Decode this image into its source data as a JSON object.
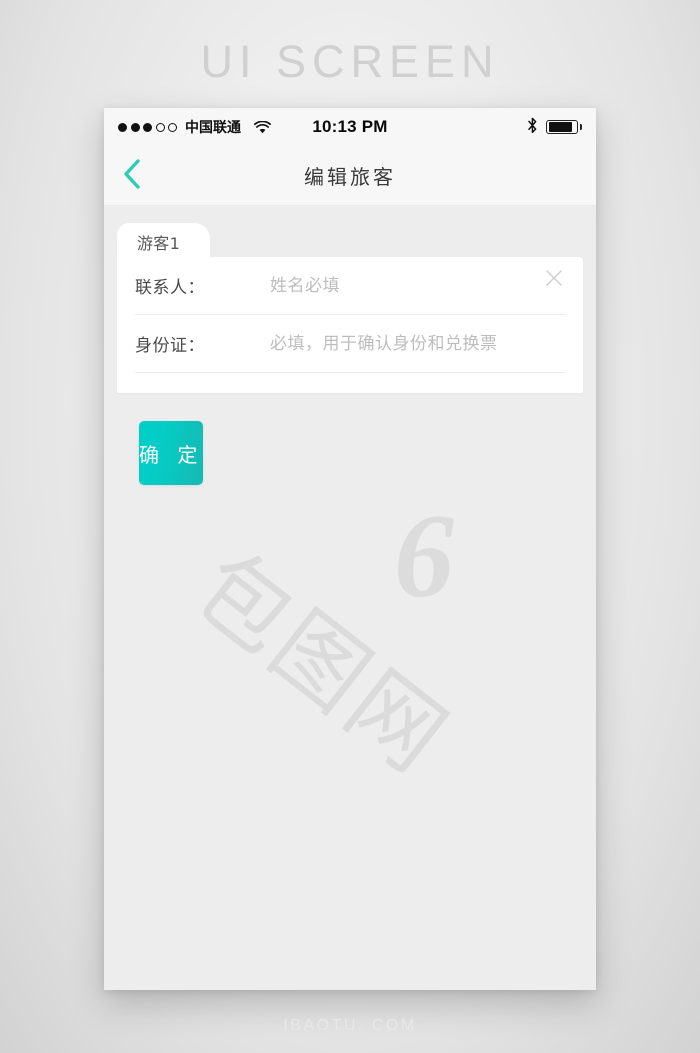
{
  "poster": {
    "title": "UI SCREEN",
    "footer": "IBAOTU. COM",
    "watermark_text": "包图网",
    "watermark_logo": "6"
  },
  "status_bar": {
    "signal_filled": 3,
    "signal_empty": 2,
    "carrier": "中国联通",
    "wifi_icon": "wifi-icon",
    "time": "10:13 PM",
    "bluetooth_icon": "bluetooth-icon",
    "battery_icon": "battery-icon",
    "battery_level": 88
  },
  "nav_bar": {
    "back_icon": "chevron-left-icon",
    "title": "编辑旅客"
  },
  "passenger_card": {
    "tab_label": "游客1",
    "close_icon": "close-icon",
    "fields": [
      {
        "label": "联系人：",
        "value": "",
        "placeholder": "姓名必填",
        "name": "contact-name"
      },
      {
        "label": "身份证：",
        "value": "",
        "placeholder": "必填，用于确认身份和兑换票",
        "name": "id-number"
      }
    ]
  },
  "confirm_button": {
    "label": "确 定"
  },
  "colors": {
    "accent": "#00cfc8",
    "accent_dark": "#16b9b2",
    "back_chevron": "#2ecdb3",
    "nav_bg": "#f7f7f7",
    "screen_bg": "#ededed",
    "card_bg": "#ffffff",
    "label_text": "#4a4a4a",
    "placeholder_text": "#bdbdbd",
    "poster_title": "#d0d0d0"
  }
}
